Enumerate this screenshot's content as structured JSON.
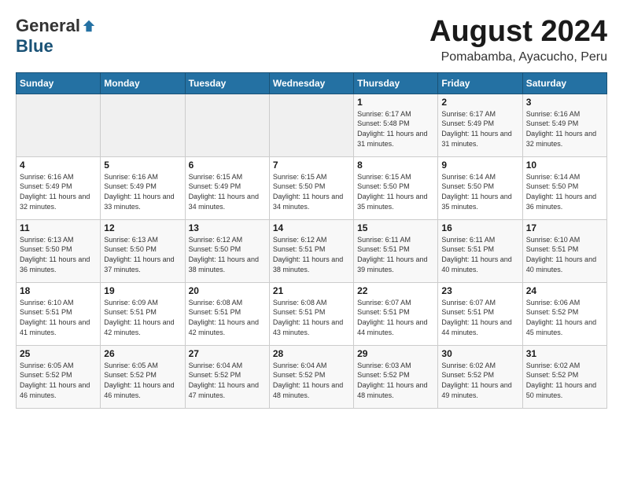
{
  "logo": {
    "general": "General",
    "blue": "Blue"
  },
  "title": {
    "month_year": "August 2024",
    "location": "Pomabamba, Ayacucho, Peru"
  },
  "headers": [
    "Sunday",
    "Monday",
    "Tuesday",
    "Wednesday",
    "Thursday",
    "Friday",
    "Saturday"
  ],
  "weeks": [
    [
      {
        "day": "",
        "sunrise": "",
        "sunset": "",
        "daylight": ""
      },
      {
        "day": "",
        "sunrise": "",
        "sunset": "",
        "daylight": ""
      },
      {
        "day": "",
        "sunrise": "",
        "sunset": "",
        "daylight": ""
      },
      {
        "day": "",
        "sunrise": "",
        "sunset": "",
        "daylight": ""
      },
      {
        "day": "1",
        "sunrise": "Sunrise: 6:17 AM",
        "sunset": "Sunset: 5:48 PM",
        "daylight": "Daylight: 11 hours and 31 minutes."
      },
      {
        "day": "2",
        "sunrise": "Sunrise: 6:17 AM",
        "sunset": "Sunset: 5:49 PM",
        "daylight": "Daylight: 11 hours and 31 minutes."
      },
      {
        "day": "3",
        "sunrise": "Sunrise: 6:16 AM",
        "sunset": "Sunset: 5:49 PM",
        "daylight": "Daylight: 11 hours and 32 minutes."
      }
    ],
    [
      {
        "day": "4",
        "sunrise": "Sunrise: 6:16 AM",
        "sunset": "Sunset: 5:49 PM",
        "daylight": "Daylight: 11 hours and 32 minutes."
      },
      {
        "day": "5",
        "sunrise": "Sunrise: 6:16 AM",
        "sunset": "Sunset: 5:49 PM",
        "daylight": "Daylight: 11 hours and 33 minutes."
      },
      {
        "day": "6",
        "sunrise": "Sunrise: 6:15 AM",
        "sunset": "Sunset: 5:49 PM",
        "daylight": "Daylight: 11 hours and 34 minutes."
      },
      {
        "day": "7",
        "sunrise": "Sunrise: 6:15 AM",
        "sunset": "Sunset: 5:50 PM",
        "daylight": "Daylight: 11 hours and 34 minutes."
      },
      {
        "day": "8",
        "sunrise": "Sunrise: 6:15 AM",
        "sunset": "Sunset: 5:50 PM",
        "daylight": "Daylight: 11 hours and 35 minutes."
      },
      {
        "day": "9",
        "sunrise": "Sunrise: 6:14 AM",
        "sunset": "Sunset: 5:50 PM",
        "daylight": "Daylight: 11 hours and 35 minutes."
      },
      {
        "day": "10",
        "sunrise": "Sunrise: 6:14 AM",
        "sunset": "Sunset: 5:50 PM",
        "daylight": "Daylight: 11 hours and 36 minutes."
      }
    ],
    [
      {
        "day": "11",
        "sunrise": "Sunrise: 6:13 AM",
        "sunset": "Sunset: 5:50 PM",
        "daylight": "Daylight: 11 hours and 36 minutes."
      },
      {
        "day": "12",
        "sunrise": "Sunrise: 6:13 AM",
        "sunset": "Sunset: 5:50 PM",
        "daylight": "Daylight: 11 hours and 37 minutes."
      },
      {
        "day": "13",
        "sunrise": "Sunrise: 6:12 AM",
        "sunset": "Sunset: 5:50 PM",
        "daylight": "Daylight: 11 hours and 38 minutes."
      },
      {
        "day": "14",
        "sunrise": "Sunrise: 6:12 AM",
        "sunset": "Sunset: 5:51 PM",
        "daylight": "Daylight: 11 hours and 38 minutes."
      },
      {
        "day": "15",
        "sunrise": "Sunrise: 6:11 AM",
        "sunset": "Sunset: 5:51 PM",
        "daylight": "Daylight: 11 hours and 39 minutes."
      },
      {
        "day": "16",
        "sunrise": "Sunrise: 6:11 AM",
        "sunset": "Sunset: 5:51 PM",
        "daylight": "Daylight: 11 hours and 40 minutes."
      },
      {
        "day": "17",
        "sunrise": "Sunrise: 6:10 AM",
        "sunset": "Sunset: 5:51 PM",
        "daylight": "Daylight: 11 hours and 40 minutes."
      }
    ],
    [
      {
        "day": "18",
        "sunrise": "Sunrise: 6:10 AM",
        "sunset": "Sunset: 5:51 PM",
        "daylight": "Daylight: 11 hours and 41 minutes."
      },
      {
        "day": "19",
        "sunrise": "Sunrise: 6:09 AM",
        "sunset": "Sunset: 5:51 PM",
        "daylight": "Daylight: 11 hours and 42 minutes."
      },
      {
        "day": "20",
        "sunrise": "Sunrise: 6:08 AM",
        "sunset": "Sunset: 5:51 PM",
        "daylight": "Daylight: 11 hours and 42 minutes."
      },
      {
        "day": "21",
        "sunrise": "Sunrise: 6:08 AM",
        "sunset": "Sunset: 5:51 PM",
        "daylight": "Daylight: 11 hours and 43 minutes."
      },
      {
        "day": "22",
        "sunrise": "Sunrise: 6:07 AM",
        "sunset": "Sunset: 5:51 PM",
        "daylight": "Daylight: 11 hours and 44 minutes."
      },
      {
        "day": "23",
        "sunrise": "Sunrise: 6:07 AM",
        "sunset": "Sunset: 5:51 PM",
        "daylight": "Daylight: 11 hours and 44 minutes."
      },
      {
        "day": "24",
        "sunrise": "Sunrise: 6:06 AM",
        "sunset": "Sunset: 5:52 PM",
        "daylight": "Daylight: 11 hours and 45 minutes."
      }
    ],
    [
      {
        "day": "25",
        "sunrise": "Sunrise: 6:05 AM",
        "sunset": "Sunset: 5:52 PM",
        "daylight": "Daylight: 11 hours and 46 minutes."
      },
      {
        "day": "26",
        "sunrise": "Sunrise: 6:05 AM",
        "sunset": "Sunset: 5:52 PM",
        "daylight": "Daylight: 11 hours and 46 minutes."
      },
      {
        "day": "27",
        "sunrise": "Sunrise: 6:04 AM",
        "sunset": "Sunset: 5:52 PM",
        "daylight": "Daylight: 11 hours and 47 minutes."
      },
      {
        "day": "28",
        "sunrise": "Sunrise: 6:04 AM",
        "sunset": "Sunset: 5:52 PM",
        "daylight": "Daylight: 11 hours and 48 minutes."
      },
      {
        "day": "29",
        "sunrise": "Sunrise: 6:03 AM",
        "sunset": "Sunset: 5:52 PM",
        "daylight": "Daylight: 11 hours and 48 minutes."
      },
      {
        "day": "30",
        "sunrise": "Sunrise: 6:02 AM",
        "sunset": "Sunset: 5:52 PM",
        "daylight": "Daylight: 11 hours and 49 minutes."
      },
      {
        "day": "31",
        "sunrise": "Sunrise: 6:02 AM",
        "sunset": "Sunset: 5:52 PM",
        "daylight": "Daylight: 11 hours and 50 minutes."
      }
    ]
  ]
}
